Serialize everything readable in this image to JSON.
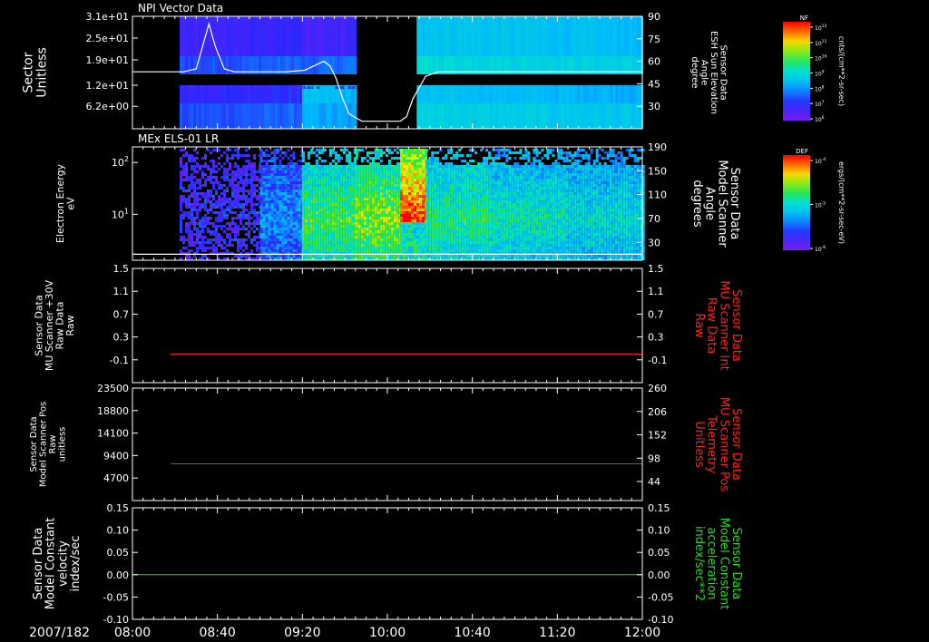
{
  "time_axis": {
    "date": "2007/182",
    "ticks": [
      "08:00",
      "08:40",
      "09:20",
      "10:00",
      "10:40",
      "11:20",
      "12:00"
    ],
    "tick_hours": [
      8.0,
      8.6667,
      9.3333,
      10.0,
      10.6667,
      11.3333,
      12.0
    ],
    "range_hours": [
      8.0,
      12.0
    ]
  },
  "colorbars": [
    {
      "tag": "NF",
      "unit": "cnts/(cm**2-sr-sec)",
      "tick_labels": [
        "10^12",
        "10^11",
        "10^10",
        "10^9",
        "10^8",
        "10^7",
        "10^6"
      ]
    },
    {
      "tag": "DEF",
      "unit": "ergs/(cm**2-sr-sec-eV)",
      "tick_labels": [
        "10^-4",
        "10^-5",
        "10^-6"
      ]
    }
  ],
  "chart_data": [
    {
      "type": "heatmap",
      "title": "NPI Vector Data",
      "ylabel": [
        "Sector",
        "Unitless"
      ],
      "yticks": [
        "3.1e+01",
        "2.5e+01",
        "1.9e+01",
        "1.2e+01",
        "6.2e+00"
      ],
      "ytick_values": [
        31,
        25,
        19,
        12,
        6.2
      ],
      "ylim": [
        0,
        31
      ],
      "y2label": [
        "Sensor Data",
        "ESH Sun Elevation",
        "Angle",
        "degree"
      ],
      "y2ticks": [
        "90",
        "75",
        "60",
        "45",
        "30"
      ],
      "y2tick_values": [
        90,
        75,
        60,
        45,
        30
      ],
      "y2lim": [
        15,
        90
      ],
      "blocks": [
        {
          "t0": 8.37,
          "t1": 9.33,
          "s0": 20,
          "s1": 31,
          "level": 0.12
        },
        {
          "t0": 8.37,
          "t1": 9.33,
          "s0": 15,
          "s1": 20,
          "level": 0.22
        },
        {
          "t0": 9.33,
          "t1": 9.75,
          "s0": 20,
          "s1": 31,
          "level": 0.1
        },
        {
          "t0": 9.33,
          "t1": 9.75,
          "s0": 15,
          "s1": 20,
          "level": 0.24
        },
        {
          "t0": 8.37,
          "t1": 9.33,
          "s0": 7,
          "s1": 12,
          "level": 0.15
        },
        {
          "t0": 8.37,
          "t1": 9.33,
          "s0": 0,
          "s1": 7,
          "level": 0.22
        },
        {
          "t0": 9.33,
          "t1": 9.75,
          "s0": 7,
          "s1": 12,
          "level": 0.4
        },
        {
          "t0": 9.33,
          "t1": 9.75,
          "s0": 0,
          "s1": 7,
          "level": 0.36
        },
        {
          "t0": 10.23,
          "t1": 12.0,
          "s0": 20,
          "s1": 31,
          "level": 0.42
        },
        {
          "t0": 10.23,
          "t1": 12.0,
          "s0": 15,
          "s1": 20,
          "level": 0.48
        },
        {
          "t0": 10.23,
          "t1": 12.0,
          "s0": 7,
          "s1": 12,
          "level": 0.4
        },
        {
          "t0": 10.23,
          "t1": 12.0,
          "s0": 0,
          "s1": 7,
          "level": 0.45
        }
      ],
      "series": [
        {
          "name": "ESH Sun Elevation",
          "color": "#ffffff",
          "x": [
            8.0,
            8.4,
            8.5,
            8.55,
            8.6,
            8.65,
            8.72,
            8.8,
            9.0,
            9.2,
            9.35,
            9.45,
            9.5,
            9.55,
            9.6,
            9.65,
            9.7,
            9.8,
            9.9,
            10.1,
            10.15,
            10.2,
            10.3,
            10.4,
            10.6,
            11.0,
            11.5,
            12.0
          ],
          "y": [
            53,
            53,
            55,
            70,
            85,
            70,
            55,
            53,
            53,
            53,
            54,
            58,
            60,
            57,
            48,
            35,
            25,
            20,
            20,
            20,
            23,
            35,
            50,
            53,
            53,
            53,
            53,
            53
          ]
        }
      ]
    },
    {
      "type": "heatmap",
      "title": "MEx ELS-01 LR",
      "ylabel": [
        "Electron Energy",
        "eV"
      ],
      "ylog": true,
      "yticks": [
        "10^2",
        "10^1"
      ],
      "ytick_values": [
        100,
        10
      ],
      "ylim": [
        1.3,
        200
      ],
      "y2label": [
        "Sensor Data",
        "Model Scanner",
        "Angle",
        "degrees"
      ],
      "y2ticks": [
        "190",
        "150",
        "110",
        "70",
        "30"
      ],
      "y2tick_values": [
        190,
        150,
        110,
        70,
        30
      ],
      "y2lim": [
        0,
        190
      ],
      "spectrum": [
        {
          "t0": 8.37,
          "t1": 9.0,
          "level": 0.16
        },
        {
          "t0": 9.0,
          "t1": 9.33,
          "level": 0.3
        },
        {
          "t0": 9.33,
          "t1": 9.75,
          "level": 0.62
        },
        {
          "t0": 9.75,
          "t1": 10.1,
          "level": 0.7
        },
        {
          "t0": 10.1,
          "t1": 10.3,
          "level": 0.96
        },
        {
          "t0": 10.3,
          "t1": 10.8,
          "level": 0.58
        },
        {
          "t0": 10.8,
          "t1": 11.4,
          "level": 0.52
        },
        {
          "t0": 11.4,
          "t1": 12.0,
          "level": 0.48
        }
      ],
      "series": [
        {
          "name": "Model Scanner Angle",
          "color": "#ffffff",
          "x": [
            8.0,
            12.0
          ],
          "y": [
            10,
            10
          ]
        }
      ]
    },
    {
      "type": "line",
      "ylabel": [
        "Sensor Data",
        "MU Scanner +30V",
        "Raw Data",
        "Raw"
      ],
      "yticks": [
        "1.5",
        "1.1",
        "0.7",
        "0.3",
        "-0.1"
      ],
      "ytick_values": [
        1.5,
        1.1,
        0.7,
        0.3,
        -0.1
      ],
      "ylim": [
        -0.5,
        1.5
      ],
      "y2label": [
        "Sensor Data",
        "MU Scanner Int",
        "Raw Data",
        "Raw"
      ],
      "y2ticks": [
        "1.5",
        "1.1",
        "0.7",
        "0.3",
        "-0.1"
      ],
      "y2tick_values": [
        1.5,
        1.1,
        0.7,
        0.3,
        -0.1
      ],
      "y2lim": [
        -0.5,
        1.5
      ],
      "series": [
        {
          "color": "#ff2020",
          "axis": "right",
          "x": [
            8.3,
            12.0
          ],
          "y": [
            0.0,
            0.0
          ]
        }
      ]
    },
    {
      "type": "line",
      "ylabel": [
        "Sensor Data",
        "Model Scanner Pos",
        "Raw",
        "unitless"
      ],
      "yticks": [
        "23500",
        "18800",
        "14100",
        "9400",
        "4700"
      ],
      "ytick_values": [
        23500,
        18800,
        14100,
        9400,
        4700
      ],
      "ylim": [
        0,
        23500
      ],
      "y2label": [
        "Sensor Data",
        "MU Scanner Pos",
        "Telemetry",
        "Unitless"
      ],
      "y2ticks": [
        "260",
        "206",
        "152",
        "98",
        "44"
      ],
      "y2tick_values": [
        260,
        206,
        152,
        98,
        44
      ],
      "y2lim": [
        0,
        260
      ],
      "series": [
        {
          "color": "#ff2020",
          "axis": "right",
          "x": [
            8.3,
            12.0
          ],
          "y": [
            85,
            85
          ]
        }
      ]
    },
    {
      "type": "line",
      "ylabel": [
        "Sensor Data",
        "Model Constant",
        "velocity",
        "index/sec"
      ],
      "yticks": [
        "0.15",
        "0.10",
        "0.05",
        "0.00",
        "-0.05",
        "-0.10"
      ],
      "ytick_values": [
        0.15,
        0.1,
        0.05,
        0.0,
        -0.05,
        -0.1
      ],
      "ylim": [
        -0.1,
        0.15
      ],
      "y2label": [
        "Sensor Data",
        "Model Constant",
        "acceleration",
        "index/sec**2"
      ],
      "y2ticks": [
        "0.15",
        "0.10",
        "0.05",
        "0.00",
        "-0.05",
        "-0.10"
      ],
      "y2tick_values": [
        0.15,
        0.1,
        0.05,
        0.0,
        -0.05,
        -0.1
      ],
      "y2lim": [
        -0.1,
        0.15
      ],
      "series": [
        {
          "color": "#22dd22",
          "axis": "right",
          "x": [
            8.0,
            12.0
          ],
          "y": [
            0.0,
            0.0
          ]
        }
      ]
    }
  ],
  "right_label_colors": [
    "#ffffff",
    "#ffffff",
    "#ff2020",
    "#ff2020",
    "#22dd22"
  ]
}
